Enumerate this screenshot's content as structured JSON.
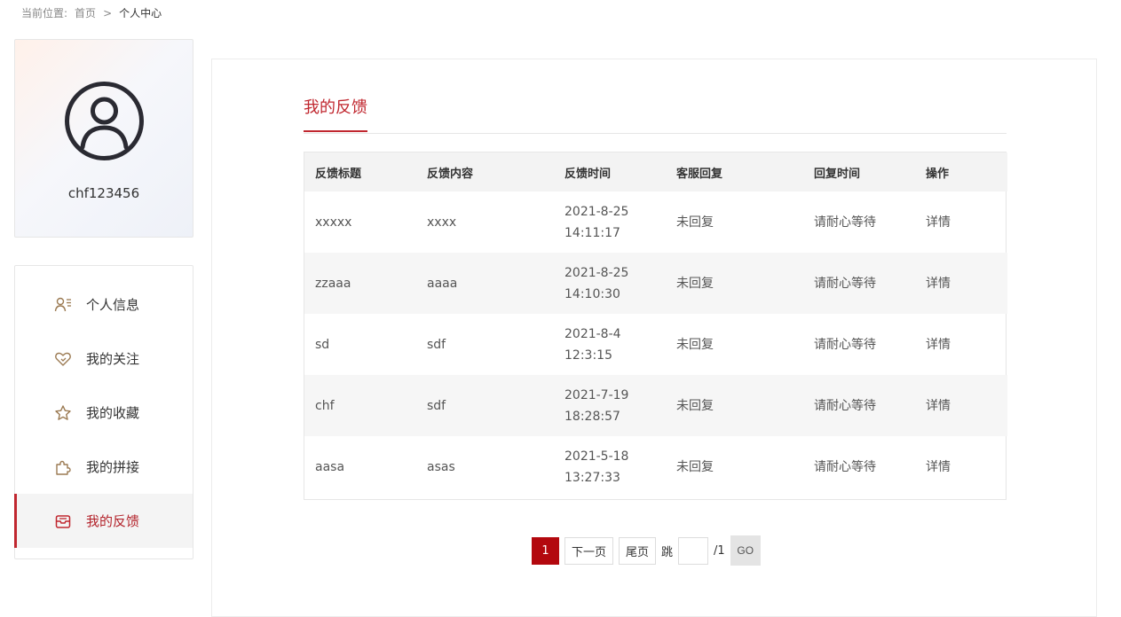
{
  "breadcrumb": {
    "prefix": "当前位置:",
    "home": "首页",
    "separator": ">",
    "current": "个人中心"
  },
  "profile": {
    "username": "chf123456",
    "avatar_icon": "user-circle-icon"
  },
  "menu": {
    "items": [
      {
        "label": "个人信息",
        "icon": "user-info-icon"
      },
      {
        "label": "我的关注",
        "icon": "heart-icon"
      },
      {
        "label": "我的收藏",
        "icon": "star-icon"
      },
      {
        "label": "我的拼接",
        "icon": "puzzle-icon"
      },
      {
        "label": "我的反馈",
        "icon": "inbox-icon",
        "active": true
      }
    ]
  },
  "main": {
    "tab_title": "我的反馈",
    "columns": [
      "反馈标题",
      "反馈内容",
      "反馈时间",
      "客服回复",
      "回复时间",
      "操作"
    ],
    "rows": [
      {
        "title": "xxxxx",
        "content": "xxxx",
        "date": "2021-8-25",
        "time": "14:11:17",
        "reply": "未回复",
        "reply_time": "请耐心等待",
        "action": "详情"
      },
      {
        "title": "zzaaa",
        "content": "aaaa",
        "date": "2021-8-25",
        "time": "14:10:30",
        "reply": "未回复",
        "reply_time": "请耐心等待",
        "action": "详情"
      },
      {
        "title": "sd",
        "content": "sdf",
        "date": "2021-8-4",
        "time": "12:3:15",
        "reply": "未回复",
        "reply_time": "请耐心等待",
        "action": "详情"
      },
      {
        "title": "chf",
        "content": "sdf",
        "date": "2021-7-19",
        "time": "18:28:57",
        "reply": "未回复",
        "reply_time": "请耐心等待",
        "action": "详情"
      },
      {
        "title": "aasa",
        "content": "asas",
        "date": "2021-5-18",
        "time": "13:27:33",
        "reply": "未回复",
        "reply_time": "请耐心等待",
        "action": "详情"
      }
    ]
  },
  "pagination": {
    "current_page": "1",
    "next_label": "下一页",
    "last_label": "尾页",
    "jump_label": "跳",
    "jump_value": "",
    "total_label": "/1",
    "go_label": "GO"
  },
  "colors": {
    "accent": "#c0272f",
    "active_page": "#b3080e",
    "icon_tan": "#9b7a52"
  }
}
